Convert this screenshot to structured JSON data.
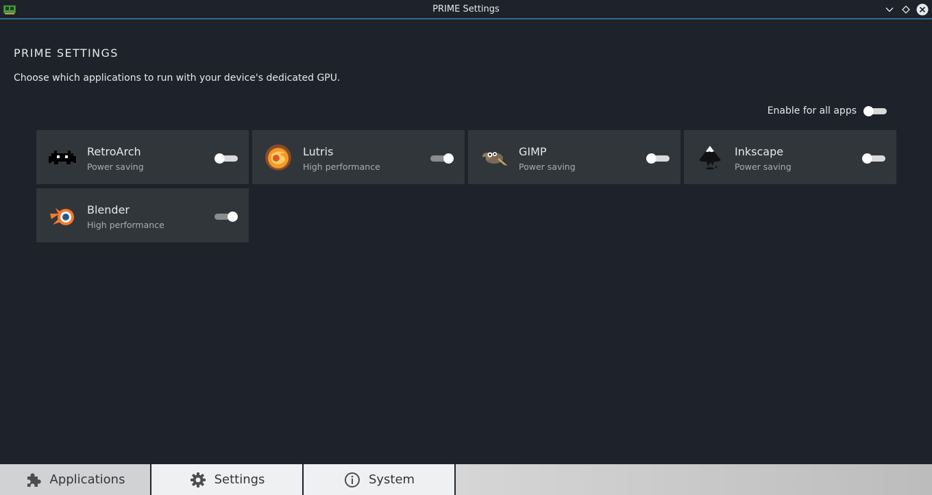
{
  "window": {
    "title": "PRIME Settings"
  },
  "page": {
    "heading": "PRIME SETTINGS",
    "description": "Choose which applications to run with your device's dedicated GPU."
  },
  "enable_all": {
    "label": "Enable for all apps",
    "enabled": false
  },
  "apps": [
    {
      "name": "RetroArch",
      "mode": "Power saving",
      "enabled": false,
      "icon": "retroarch-icon"
    },
    {
      "name": "Lutris",
      "mode": "High performance",
      "enabled": true,
      "icon": "lutris-icon"
    },
    {
      "name": "GIMP",
      "mode": "Power saving",
      "enabled": false,
      "icon": "gimp-icon"
    },
    {
      "name": "Inkscape",
      "mode": "Power saving",
      "enabled": false,
      "icon": "inkscape-icon"
    },
    {
      "name": "Blender",
      "mode": "High performance",
      "enabled": true,
      "icon": "blender-icon"
    }
  ],
  "tabs": [
    {
      "label": "Applications",
      "icon": "puzzle-icon",
      "active": true
    },
    {
      "label": "Settings",
      "icon": "gear-icon",
      "active": false
    },
    {
      "label": "System",
      "icon": "info-icon",
      "active": false
    }
  ],
  "colors": {
    "accent": "#3daee9",
    "background": "#1e222a",
    "card": "#31363b"
  }
}
